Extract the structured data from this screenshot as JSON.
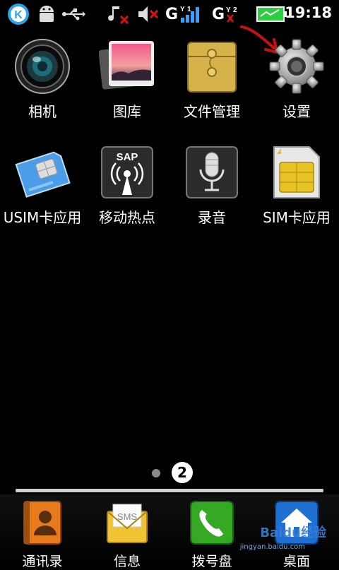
{
  "status_bar": {
    "time": "19:18",
    "icons": [
      "kuaibo-k-icon",
      "android-icon",
      "usb-icon",
      "music-muted-icon",
      "volume-muted-icon",
      "signal-g1-icon",
      "signal-g2-x-icon",
      "battery-icon"
    ],
    "signal_labels": {
      "g1": "G",
      "g2": "G",
      "sub1": "1",
      "sub2": "2"
    }
  },
  "apps": [
    {
      "id": "camera",
      "label": "相机",
      "icon": "camera-icon"
    },
    {
      "id": "gallery",
      "label": "图库",
      "icon": "gallery-icon"
    },
    {
      "id": "files",
      "label": "文件管理",
      "icon": "folder-icon"
    },
    {
      "id": "settings",
      "label": "设置",
      "icon": "gear-icon"
    },
    {
      "id": "usim",
      "label": "USIM卡应用",
      "icon": "usim-card-icon"
    },
    {
      "id": "hotspot",
      "label": "移动热点",
      "icon": "hotspot-icon",
      "badge_text": "SAP"
    },
    {
      "id": "recorder",
      "label": "录音",
      "icon": "microphone-icon"
    },
    {
      "id": "sim",
      "label": "SIM卡应用",
      "icon": "sim-card-icon"
    }
  ],
  "page_indicator": {
    "current": "2"
  },
  "dock": [
    {
      "id": "contacts",
      "label": "通讯录",
      "icon": "contacts-icon"
    },
    {
      "id": "messages",
      "label": "信息",
      "icon": "sms-icon",
      "badge_text": "SMS"
    },
    {
      "id": "dialer",
      "label": "拨号盘",
      "icon": "phone-icon"
    },
    {
      "id": "desktop",
      "label": "桌面",
      "icon": "home-icon"
    }
  ],
  "watermark": {
    "text": "Baidu经验",
    "sub": "jingyan.baidu.com"
  },
  "colors": {
    "background": "#000000",
    "annotation_arrow": "#c81010",
    "battery": "#2ecc40"
  }
}
